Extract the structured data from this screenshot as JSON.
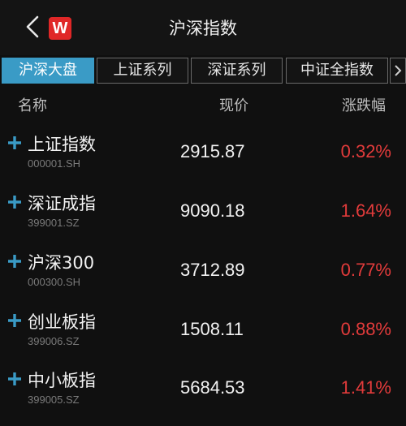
{
  "header": {
    "title": "沪深指数",
    "logo_letter": "W",
    "logo_color": "#e02727"
  },
  "tabs": [
    {
      "label": "沪深大盘",
      "active": true
    },
    {
      "label": "上证系列",
      "active": false
    },
    {
      "label": "深证系列",
      "active": false
    },
    {
      "label": "中证全指数",
      "active": false
    }
  ],
  "columns": {
    "name": "名称",
    "price": "现价",
    "change": "涨跌幅"
  },
  "rows": [
    {
      "name": "上证指数",
      "code": "000001.SH",
      "price": "2915.87",
      "change": "0.32%"
    },
    {
      "name": "深证成指",
      "code": "399001.SZ",
      "price": "9090.18",
      "change": "1.64%"
    },
    {
      "name": "沪深300",
      "code": "000300.SH",
      "price": "3712.89",
      "change": "0.77%"
    },
    {
      "name": "创业板指",
      "code": "399006.SZ",
      "price": "1508.11",
      "change": "0.88%"
    },
    {
      "name": "中小板指",
      "code": "399005.SZ",
      "price": "5684.53",
      "change": "1.41%"
    }
  ],
  "colors": {
    "accent": "#3a9bc6",
    "rise": "#e23b3b"
  },
  "icons": {
    "back": "back-arrow-icon",
    "add": "plus-icon",
    "more_tabs": "chevron-right-icon"
  }
}
